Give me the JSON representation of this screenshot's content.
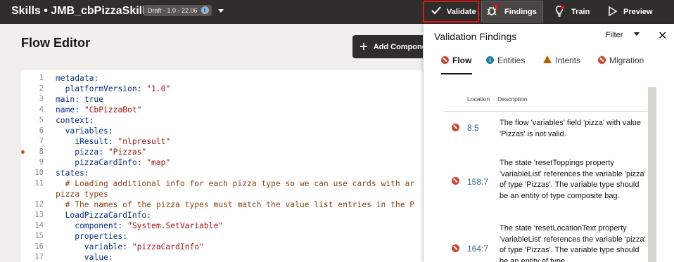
{
  "header": {
    "skill_title": "Skills • JMB_cbPizzaSkill",
    "draft_badge": "Draft - 1.0 - 22.06",
    "info_icon": "i",
    "validate_label": "Validate",
    "findings_label": "Findings",
    "train_label": "Train",
    "preview_label": "Preview"
  },
  "page": {
    "title": "Flow Editor",
    "add_component_label": "Add Compone"
  },
  "editor": {
    "lines": [
      {
        "num": "1",
        "parts": [
          {
            "t": "metadata:",
            "c": "k"
          }
        ]
      },
      {
        "num": "2",
        "parts": [
          {
            "t": "  platformVersion: ",
            "c": "k"
          },
          {
            "t": "\"1.0\"",
            "c": "s"
          }
        ]
      },
      {
        "num": "3",
        "parts": [
          {
            "t": "main: true",
            "c": "k"
          }
        ]
      },
      {
        "num": "4",
        "parts": [
          {
            "t": "name: ",
            "c": "k"
          },
          {
            "t": "\"CbPizzaBot\"",
            "c": "s"
          }
        ]
      },
      {
        "num": "5",
        "parts": [
          {
            "t": "context:",
            "c": "k"
          }
        ]
      },
      {
        "num": "6",
        "parts": [
          {
            "t": "  variables:",
            "c": "k"
          }
        ]
      },
      {
        "num": "7",
        "parts": [
          {
            "t": "    iResult: ",
            "c": "k"
          },
          {
            "t": "\"nlpresult\"",
            "c": "s"
          }
        ]
      },
      {
        "num": "8",
        "error": true,
        "parts": [
          {
            "t": "    pizza: ",
            "c": "k"
          },
          {
            "t": "\"Pizzas\"",
            "c": "s"
          }
        ]
      },
      {
        "num": "9",
        "parts": [
          {
            "t": "    pizzaCardInfo: ",
            "c": "k"
          },
          {
            "t": "\"map\"",
            "c": "s"
          }
        ]
      },
      {
        "num": "10",
        "parts": [
          {
            "t": "states:",
            "c": "k"
          }
        ]
      },
      {
        "num": "11",
        "parts": [
          {
            "t": "  # Loading additional info for each pizza type so we can use cards with ar",
            "c": "c"
          }
        ]
      },
      {
        "num": "",
        "parts": [
          {
            "t": "pizza types",
            "c": "c"
          }
        ]
      },
      {
        "num": "12",
        "parts": [
          {
            "t": "  # The names of the pizza types must match the value list entries in the P",
            "c": "c"
          }
        ]
      },
      {
        "num": "13",
        "parts": [
          {
            "t": "  LoadPizzaCardInfo:",
            "c": "k"
          }
        ]
      },
      {
        "num": "14",
        "parts": [
          {
            "t": "    component: ",
            "c": "k"
          },
          {
            "t": "\"System.SetVariable\"",
            "c": "s"
          }
        ]
      },
      {
        "num": "15",
        "parts": [
          {
            "t": "    properties:",
            "c": "k"
          }
        ]
      },
      {
        "num": "16",
        "parts": [
          {
            "t": "      variable: ",
            "c": "k"
          },
          {
            "t": "\"pizzaCardInfo\"",
            "c": "s"
          }
        ]
      },
      {
        "num": "17",
        "parts": [
          {
            "t": "      value:",
            "c": "k"
          }
        ]
      }
    ]
  },
  "panel": {
    "title": "Validation Findings",
    "filter_label": "Filter",
    "close_icon": "✕",
    "tabs": [
      {
        "label": "Flow",
        "icon": "error-icon"
      },
      {
        "label": "Entities",
        "icon": "info-icon"
      },
      {
        "label": "Intents",
        "icon": "warning-icon"
      },
      {
        "label": "Migration",
        "icon": "error-icon"
      }
    ],
    "columns": {
      "location": "Location",
      "description": "Description"
    },
    "findings": [
      {
        "location": "8:5",
        "description": "The flow 'variables' field 'pizza' with value 'Pizzas' is not valid."
      },
      {
        "location": "158:7",
        "description": "The state 'resetToppings property 'variableList' references the variable 'pizza' of type 'Pizzas'. The variable type should be an entity of type composite bag."
      },
      {
        "location": "164:7",
        "description": "The state 'resetLocationText property 'variableList' references the variable 'pizza' of type 'Pizzas'. The variable type should be an entity of type"
      }
    ]
  },
  "colors": {
    "topbar": "#312d2a",
    "validate_outline": "#e0171e",
    "error": "#c74634",
    "info": "#227c9e",
    "warning": "#b55d00",
    "location_link": "#2b6a8f"
  }
}
